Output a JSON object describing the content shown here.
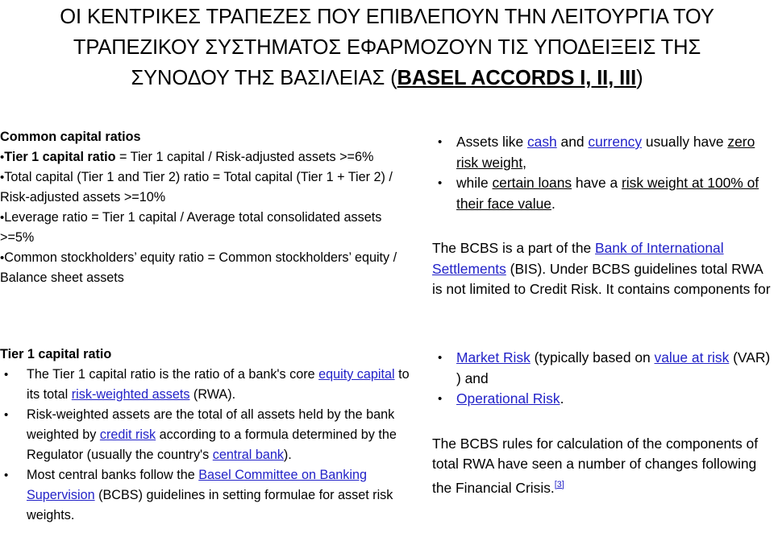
{
  "slide": {
    "title": {
      "line1": "ΟΙ ΚΕΝΤΡΙΚΕΣ ΤΡΑΠΕΖΕΣ ΠΟΥ ΕΠΙΒΛΕΠΟΥΝ ΤΗΝ ΛΕΙΤΟΥΡΓΙΑ ΤΟΥ",
      "line2": "ΤΡΑΠΕΖΙΚΟΥ ΣΥΣΤΗΜΑΤΟΣ ΕΦΑΡΜΟΖΟΥΝ ΤΙΣ ΥΠΟΔΕΙΞΕΙΣ ΤΗΣ",
      "line3_prefix": "ΣΥΝΟΔΟΥ ΤΗΣ ΒΑΣΙΛΕΙΑΣ (",
      "line3_strong": "BASEL ACCORDS I, II, III",
      "line3_suffix": ")"
    }
  },
  "left_column": {
    "ratios_block": {
      "heading": "Common capital ratios",
      "items": [
        {
          "bullet": "•",
          "bold_part": "Tier 1 capital ratio",
          "rest": " = Tier 1 capital / Risk-adjusted assets >=6%"
        },
        {
          "bullet": "•",
          "text": "Total capital (Tier 1 and Tier 2) ratio = Total capital (Tier 1 + Tier 2) / Risk-adjusted assets >=10%"
        },
        {
          "bullet": "•",
          "text": "Leverage ratio = Tier 1 capital / Average total consolidated assets >=5%"
        },
        {
          "bullet": "•",
          "text": "Common stockholders’ equity ratio = Common stockholders’ equity / Balance sheet assets"
        }
      ]
    },
    "tier1_block": {
      "heading": "Tier 1 capital ratio",
      "bullet_glyph": "•",
      "b1": {
        "p1": "The Tier 1 capital ratio is the ratio of a bank's core ",
        "link1": "equity capital",
        "p2": " to its total ",
        "link2": "risk-weighted assets",
        "p3": " (RWA)."
      },
      "b2": {
        "p1": "Risk-weighted assets are the total of all assets held by the bank weighted by ",
        "link1": "credit risk",
        "p2": " according to a formula determined by the Regulator (usually the country's ",
        "link2": "central bank",
        "p3": ")."
      },
      "b3": {
        "p1": "Most central banks follow the ",
        "link1": "Basel Committee on Banking Supervision",
        "p2": " (BCBS) guidelines in setting formulae for asset risk weights."
      }
    }
  },
  "right_column": {
    "risk_weight_block": {
      "bullet_glyph": "•",
      "b1": {
        "p1": "Assets like ",
        "link1": "cash",
        "p2": " and ",
        "link2": "currency",
        "p3": " usually have ",
        "ul1": "zero risk weight",
        "p4": ","
      },
      "b2": {
        "p1": "while ",
        "ul1": "certain loans",
        "p2": " have a ",
        "ul2": "risk weight at 100% of their face value",
        "p3": "."
      }
    },
    "bcbs_paragraph": {
      "p1": "The BCBS is a part of the ",
      "link1": "Bank of International Settlements",
      "p2": " (BIS). Under BCBS guidelines total RWA is not limited to Credit Risk. It contains components for"
    },
    "risk_components": {
      "bullet_glyph": "•",
      "b1": {
        "link1": "Market Risk",
        "p1": " (typically based on ",
        "link2": "value at risk",
        "p2": " (VAR) ) and"
      },
      "b2": {
        "link1": "Operational Risk",
        "p1": "."
      }
    },
    "closing_paragraph": {
      "p1": "The BCBS rules for calculation of the components of total RWA have seen a number of changes following the Financial Crisis.",
      "ref": "[3]"
    }
  },
  "colors": {
    "hyperlink": "#2222C8",
    "text": "#000000",
    "background": "#FFFFFF"
  }
}
